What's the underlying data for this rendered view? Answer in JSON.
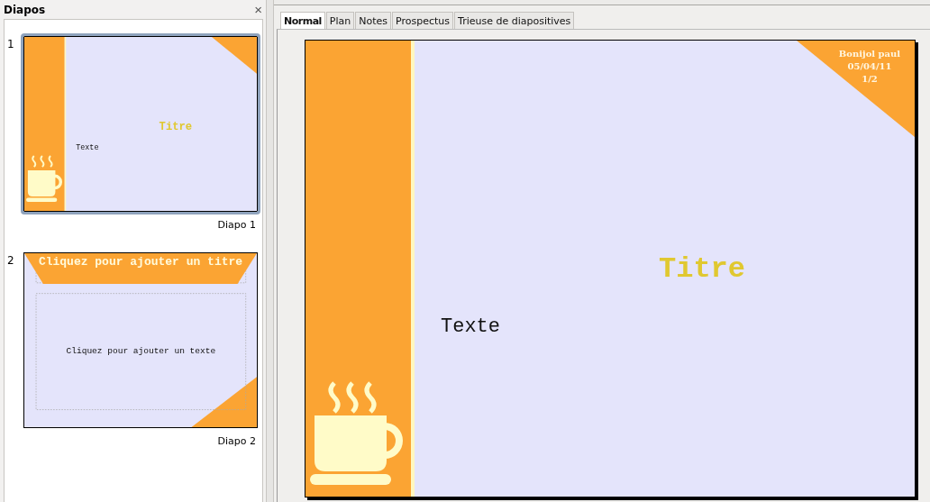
{
  "panel": {
    "title": "Diapos",
    "close": "×"
  },
  "slides": [
    {
      "number": "1",
      "label": "Diapo 1",
      "selected": true,
      "kind": "title",
      "title": "Titre",
      "text": "Texte"
    },
    {
      "number": "2",
      "label": "Diapo 2",
      "selected": false,
      "kind": "placeholder",
      "title": "Cliquez pour ajouter un titre",
      "text": "Cliquez pour ajouter un texte"
    }
  ],
  "tabs": [
    {
      "label": "Normal",
      "selected": true
    },
    {
      "label": "Plan",
      "selected": false
    },
    {
      "label": "Notes",
      "selected": false
    },
    {
      "label": "Prospectus",
      "selected": false
    },
    {
      "label": "Trieuse de diapositives",
      "selected": false
    }
  ],
  "editor": {
    "title": "Titre",
    "text": "Texte",
    "footer": [
      "Bonijol paul",
      "05/04/11",
      "1/2"
    ]
  }
}
